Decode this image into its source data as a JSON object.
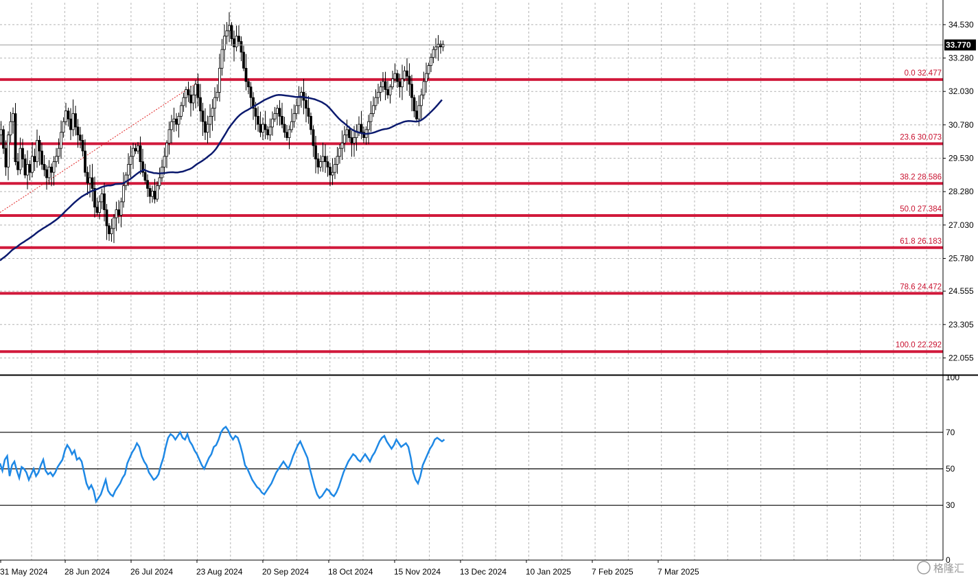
{
  "chart_data": [
    {
      "type": "candlestick",
      "title": "",
      "xlabel": "",
      "ylabel": "",
      "ylim": [
        21.45,
        35.35
      ],
      "y_ticks": [
        "34.530",
        "33.280",
        "32.030",
        "30.780",
        "29.530",
        "28.280",
        "27.030",
        "25.780",
        "24.555",
        "23.305",
        "22.055"
      ],
      "x_ticks": [
        "31 May 2024",
        "28 Jun 2024",
        "26 Jul 2024",
        "23 Aug 2024",
        "20 Sep 2024",
        "18 Oct 2024",
        "15 Nov 2024",
        "13 Dec 2024",
        "10 Jan 2025",
        "7 Feb 2025",
        "7 Mar 2025"
      ],
      "current_price": "33.770",
      "bar_step": 3.5,
      "series_close": [
        30.6,
        29.9,
        29.2,
        30.4,
        30.9,
        31.2,
        29.4,
        29.1,
        29.9,
        29.5,
        28.9,
        29.3,
        29.0,
        29.6,
        29.4,
        30.2,
        29.8,
        29.3,
        29.1,
        28.8,
        29.2,
        29.0,
        29.4,
        29.6,
        29.9,
        30.5,
        30.9,
        31.3,
        31.0,
        30.6,
        31.2,
        30.7,
        30.4,
        30.2,
        29.8,
        29.0,
        28.6,
        28.8,
        28.4,
        27.7,
        27.5,
        27.9,
        28.2,
        27.6,
        27.0,
        26.7,
        26.9,
        27.3,
        27.6,
        27.4,
        27.9,
        28.5,
        28.9,
        29.3,
        29.6,
        29.9,
        29.8,
        30.0,
        29.4,
        29.0,
        28.7,
        28.4,
        28.1,
        28.3,
        28.0,
        28.5,
        28.8,
        29.2,
        29.6,
        30.1,
        30.6,
        30.9,
        31.0,
        30.8,
        31.1,
        31.5,
        31.8,
        32.1,
        31.9,
        31.6,
        31.9,
        32.3,
        31.8,
        31.3,
        30.9,
        30.5,
        30.8,
        31.1,
        31.4,
        31.8,
        32.0,
        32.9,
        33.6,
        34.1,
        34.3,
        34.5,
        34.0,
        33.7,
        34.1,
        33.9,
        33.5,
        32.9,
        32.4,
        32.2,
        31.8,
        31.4,
        31.1,
        30.8,
        30.5,
        30.8,
        30.6,
        30.4,
        30.7,
        31.0,
        31.2,
        31.4,
        31.1,
        30.8,
        30.5,
        30.3,
        30.6,
        30.9,
        31.2,
        31.5,
        31.8,
        32.0,
        31.7,
        31.4,
        31.1,
        30.6,
        30.0,
        29.5,
        29.2,
        29.4,
        29.6,
        29.4,
        29.2,
        28.9,
        29.0,
        29.3,
        29.6,
        29.9,
        30.1,
        30.4,
        30.6,
        30.3,
        30.1,
        30.3,
        30.5,
        30.8,
        30.5,
        30.3,
        30.6,
        30.9,
        31.2,
        31.5,
        31.8,
        32.0,
        32.2,
        32.4,
        32.1,
        31.9,
        32.2,
        32.5,
        32.7,
        32.4,
        32.2,
        32.5,
        32.8,
        32.6,
        32.3,
        31.8,
        31.3,
        31.0,
        31.5,
        31.9,
        32.4,
        32.7,
        33.0,
        33.3,
        33.6,
        33.7,
        33.8,
        33.7,
        33.8
      ],
      "fibonacci": [
        {
          "level": "0.0",
          "price": 32.477,
          "label": "0.0 32.477"
        },
        {
          "level": "23.6",
          "price": 30.073,
          "label": "23.6 30.073"
        },
        {
          "level": "38.2",
          "price": 28.586,
          "label": "38.2 28.586"
        },
        {
          "level": "50.0",
          "price": 27.384,
          "label": "50.0 27.384"
        },
        {
          "level": "61.8",
          "price": 26.183,
          "label": "61.8 26.183"
        },
        {
          "level": "78.6",
          "price": 24.472,
          "label": "78.6 24.472"
        },
        {
          "level": "100.0",
          "price": 22.292,
          "label": "100.0 22.292"
        }
      ],
      "colors": {
        "candle": "#000000",
        "ma": "#0b1a6e",
        "fib": "#d1193b",
        "trend": "#e02020",
        "grid": "#b4b4b4",
        "current_bg": "#000000"
      }
    },
    {
      "type": "line",
      "title": "",
      "name": "",
      "ylim": [
        0,
        100
      ],
      "y_ticks": [
        "100",
        "70",
        "50",
        "30",
        "0"
      ],
      "levels": [
        70,
        50,
        30
      ],
      "values": [
        53,
        49,
        55,
        57,
        46,
        52,
        54,
        49,
        45,
        51,
        50,
        48,
        44,
        47,
        50,
        46,
        48,
        52,
        55,
        49,
        47,
        48,
        46,
        48,
        51,
        53,
        55,
        60,
        63,
        61,
        58,
        60,
        55,
        56,
        54,
        48,
        42,
        39,
        41,
        38,
        32,
        34,
        36,
        40,
        44,
        38,
        36,
        35,
        38,
        40,
        42,
        45,
        47,
        53,
        56,
        59,
        61,
        64,
        62,
        57,
        54,
        52,
        48,
        46,
        44,
        45,
        47,
        52,
        56,
        62,
        67,
        69,
        68,
        66,
        68,
        70,
        67,
        66,
        69,
        65,
        63,
        60,
        58,
        55,
        52,
        50,
        53,
        56,
        58,
        62,
        63,
        66,
        70,
        72,
        73,
        71,
        68,
        66,
        68,
        67,
        63,
        58,
        52,
        50,
        47,
        44,
        42,
        40,
        39,
        37,
        36,
        38,
        40,
        42,
        45,
        48,
        50,
        52,
        54,
        52,
        50,
        53,
        57,
        60,
        63,
        65,
        62,
        59,
        56,
        50,
        45,
        40,
        36,
        34,
        35,
        37,
        39,
        38,
        36,
        35,
        37,
        40,
        44,
        48,
        51,
        54,
        56,
        58,
        57,
        55,
        54,
        56,
        58,
        56,
        54,
        57,
        59,
        62,
        65,
        67,
        68,
        65,
        63,
        61,
        63,
        66,
        64,
        62,
        63,
        64,
        62,
        56,
        48,
        44,
        42,
        46,
        52,
        55,
        58,
        61,
        63,
        66,
        67,
        66,
        65,
        66
      ]
    }
  ],
  "watermark": "格隆汇"
}
